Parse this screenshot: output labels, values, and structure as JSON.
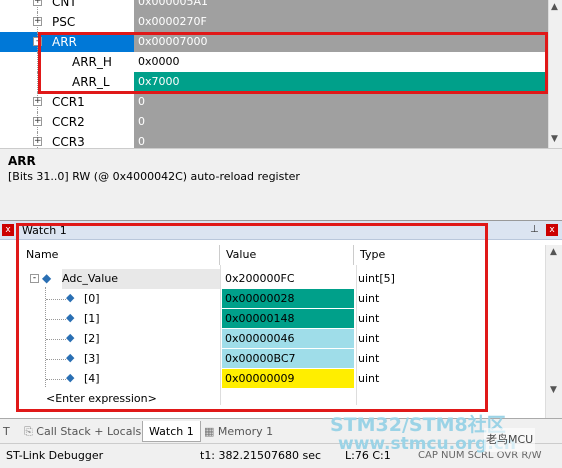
{
  "registers": {
    "rows": [
      {
        "name": "CNT",
        "value": "0x000005A1",
        "indent": 0,
        "expander": "+",
        "hl": false
      },
      {
        "name": "PSC",
        "value": "0x0000270F",
        "indent": 0,
        "expander": "+",
        "hl": false
      },
      {
        "name": "ARR",
        "value": "0x00007000",
        "indent": 0,
        "expander": "-",
        "hl": "sel"
      },
      {
        "name": "ARR_H",
        "value": "0x0000",
        "indent": 1,
        "expander": "",
        "hl": false,
        "white": true
      },
      {
        "name": "ARR_L",
        "value": "0x7000",
        "indent": 1,
        "expander": "",
        "hl": "teal"
      },
      {
        "name": "CCR1",
        "value": "0",
        "indent": 0,
        "expander": "+",
        "hl": false
      },
      {
        "name": "CCR2",
        "value": "0",
        "indent": 0,
        "expander": "+",
        "hl": false
      },
      {
        "name": "CCR3",
        "value": "0",
        "indent": 0,
        "expander": "+",
        "hl": false
      }
    ]
  },
  "description": {
    "title": "ARR",
    "detail": "[Bits 31..0] RW (@ 0x4000042C) auto-reload register"
  },
  "watch": {
    "title": "Watch 1",
    "pin": "⌂",
    "close": "x",
    "headers": {
      "name": "Name",
      "value": "Value",
      "type": "Type"
    },
    "root": {
      "name": "Adc_Value",
      "value": "0x200000FC Adc_Value",
      "type": "uint[5]"
    },
    "items": [
      {
        "name": "[0]",
        "value": "0x00000028",
        "type": "uint",
        "color": "#00a08a"
      },
      {
        "name": "[1]",
        "value": "0x00000148",
        "type": "uint",
        "color": "#00a08a"
      },
      {
        "name": "[2]",
        "value": "0x00000046",
        "type": "uint",
        "color": "#9fdde9"
      },
      {
        "name": "[3]",
        "value": "0x00000BC7",
        "type": "uint",
        "color": "#9fdde9"
      },
      {
        "name": "[4]",
        "value": "0x00000009",
        "type": "uint",
        "color": "#ffee00"
      }
    ],
    "enter": "<Enter expression>"
  },
  "tabs": {
    "call_stack": "Call Stack + Locals",
    "watch": "Watch 1",
    "memory": "Memory 1"
  },
  "status": {
    "debugger": "ST-Link Debugger",
    "time": "t1: 382.21507680 sec",
    "pos": "L:76 C:1",
    "caps": "CAP  NUM  SCRL  OVR  R/W"
  },
  "watermark": {
    "line1": "STM32/STM8社区",
    "line2": "www.stmcu.org.cn",
    "badge": "老鸟MCU"
  }
}
